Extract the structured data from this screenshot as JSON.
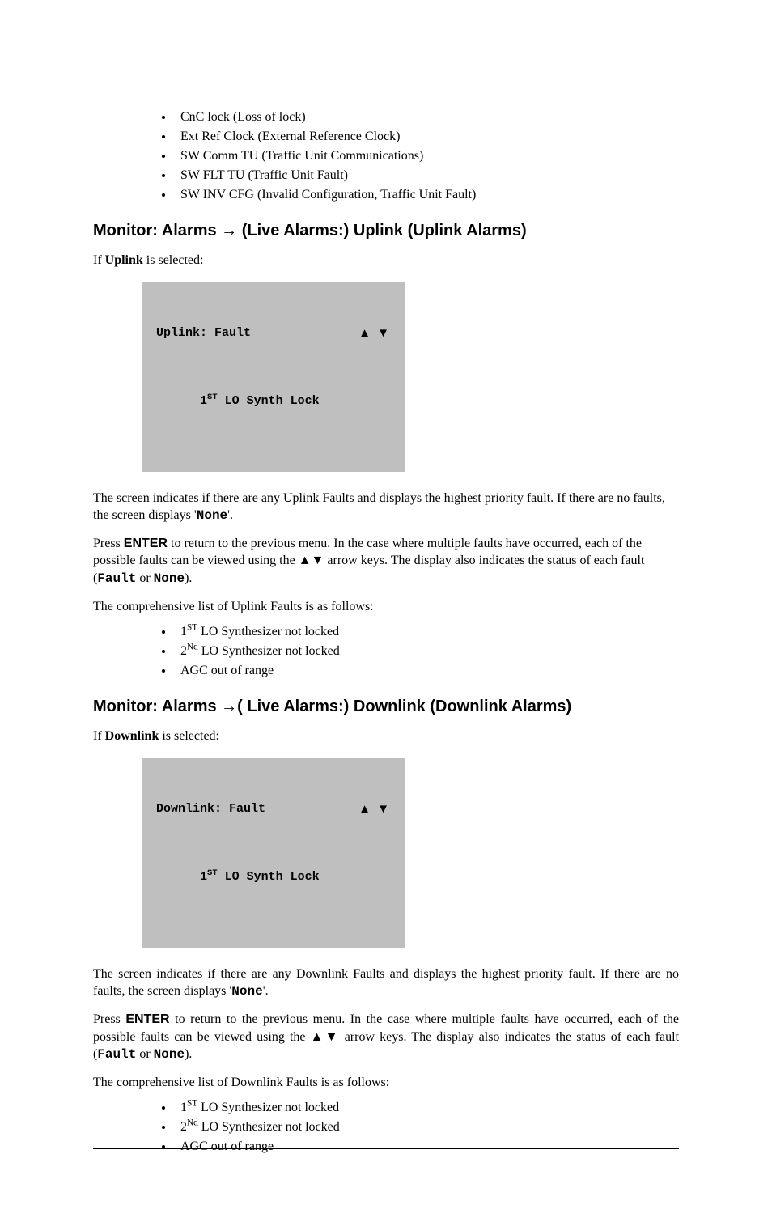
{
  "topBullets": {
    "b1": "CnC lock (Loss of lock)",
    "b2": "Ext Ref Clock (External Reference Clock)",
    "b3": "SW Comm TU (Traffic Unit Communications)",
    "b4": "SW FLT TU (Traffic Unit Fault)",
    "b5": "SW INV CFG (Invalid Configuration, Traffic Unit Fault)"
  },
  "uplink": {
    "heading_pre": "Monitor: Alarms ",
    "heading_arrow": "→",
    "heading_post": " (Live Alarms:) Uplink (Uplink Alarms)",
    "intro_pre": "If ",
    "intro_bold": "Uplink",
    "intro_post": " is selected:",
    "lcd_line1_left": "Uplink: Fault",
    "lcd_line1_right": "▲ ▼",
    "lcd_line2_pre": "1",
    "lcd_line2_sup": "ST",
    "lcd_line2_post": " LO Synth Lock",
    "para1_a": "The screen indicates if there are any Uplink Faults and displays the highest priority  fault.  If there are no faults, the screen displays '",
    "para1_none": "None",
    "para1_b": "'.",
    "para2_a": "Press ",
    "para2_enter": "ENTER",
    "para2_b": " to return to the previous menu. In the case where multiple faults have occurred, each of the possible faults can be viewed using the ",
    "para2_tri": "▲▼",
    "para2_c": " arrow keys. The display also indicates the status of each fault  (",
    "para2_fault": "Fault",
    "para2_or": " or ",
    "para2_none": "None",
    "para2_d": ").",
    "listIntro": "The comprehensive list of Uplink Faults is as follows:",
    "faults": {
      "f1_pre": "1",
      "f1_sup": "ST",
      "f1_post": " LO Synthesizer not locked",
      "f2_pre": "2",
      "f2_sup": "Nd",
      "f2_post": " LO Synthesizer not locked",
      "f3": "AGC out of range"
    }
  },
  "downlink": {
    "heading_pre": "Monitor: Alarms ",
    "heading_arrow": "→",
    "heading_post": "( Live Alarms:) Downlink (Downlink Alarms)",
    "intro_pre": "If ",
    "intro_bold": "Downlink",
    "intro_post": " is selected:",
    "lcd_line1_left": "Downlink: Fault",
    "lcd_line1_right": "▲ ▼",
    "lcd_line2_pre": "1",
    "lcd_line2_sup": "ST",
    "lcd_line2_post": " LO Synth Lock",
    "para1_a": "The screen indicates if there are any Downlink Faults and displays the highest priority fault. If there are no faults, the screen displays '",
    "para1_none": "None",
    "para1_b": "'.",
    "para2_a": "Press ",
    "para2_enter": "ENTER",
    "para2_b": " to return to the previous menu. In the case where multiple faults have occurred, each of the possible faults can be viewed using the ",
    "para2_tri": "▲▼",
    "para2_c": " arrow keys. The display also indicates the status of each fault  (",
    "para2_fault": "Fault",
    "para2_or": " or ",
    "para2_none": "None",
    "para2_d": ").",
    "listIntro": "The comprehensive list of Downlink Faults is as follows:",
    "faults": {
      "f1_pre": "1",
      "f1_sup": "ST",
      "f1_post": " LO Synthesizer not locked",
      "f2_pre": "2",
      "f2_sup": "Nd",
      "f2_post": " LO Synthesizer not locked",
      "f3": "AGC out of range"
    }
  }
}
